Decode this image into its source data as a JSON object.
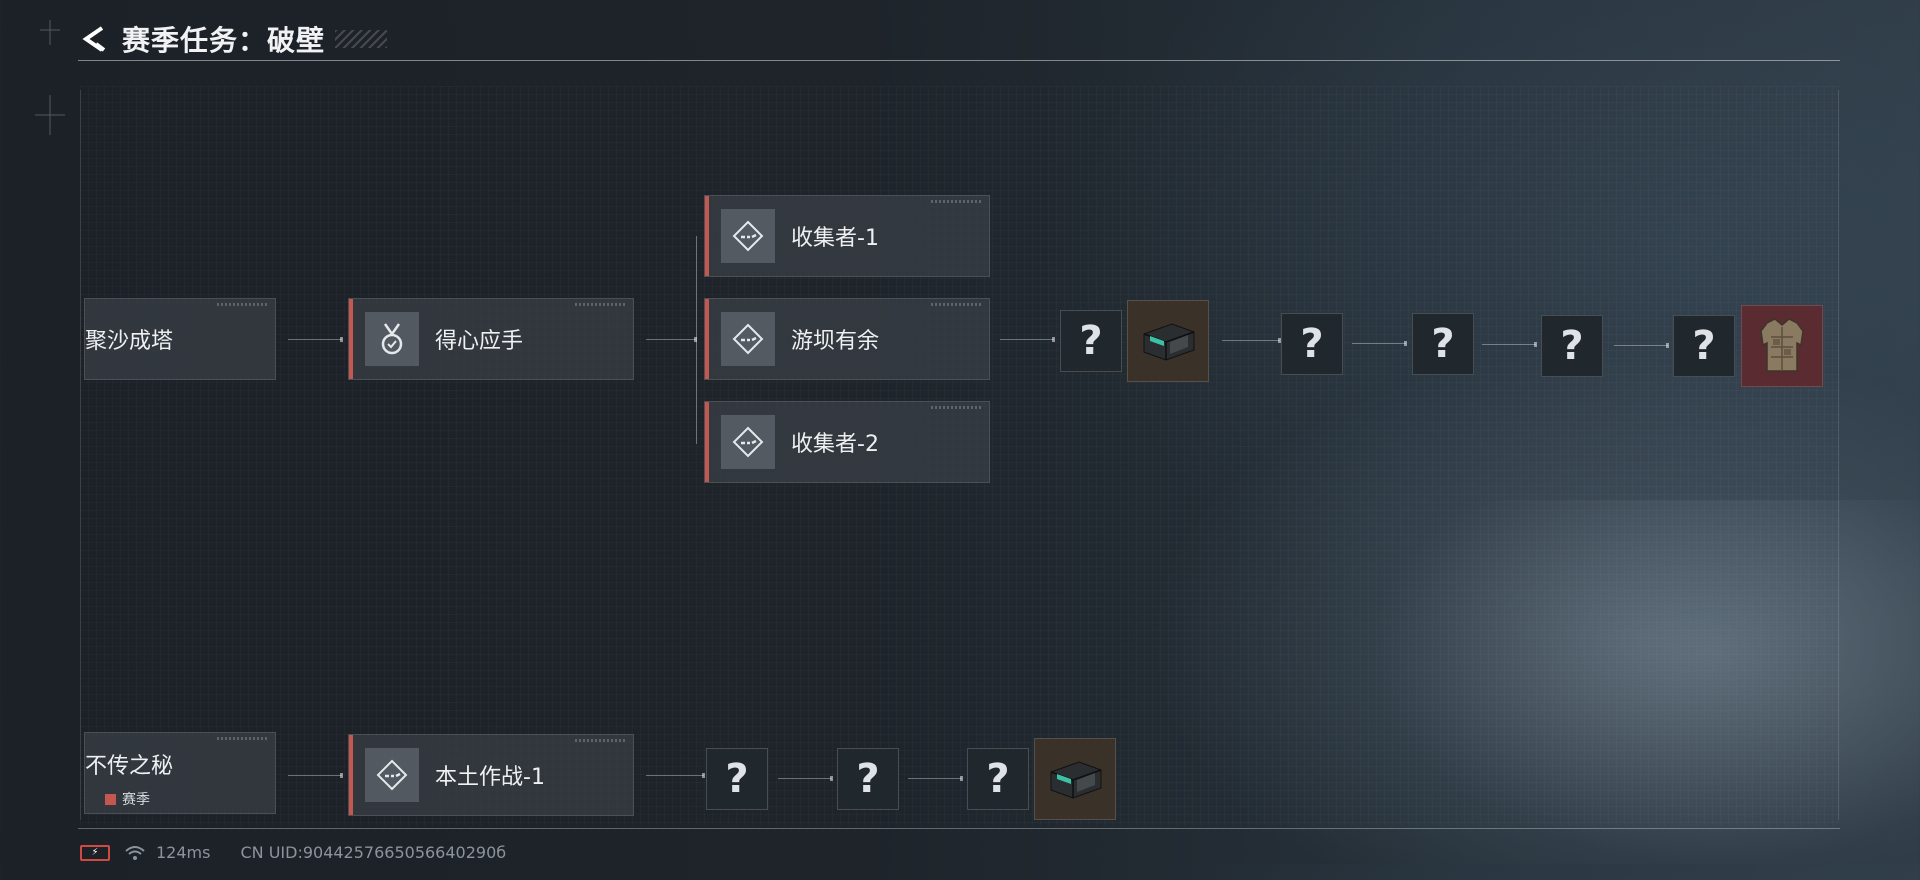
{
  "header": {
    "title": "赛季任务：破壁",
    "back_icon": "back-arrow-icon"
  },
  "row1": {
    "prev_task": "聚沙成塔",
    "task": "得心应手",
    "task_icon": "medal-icon",
    "branches": [
      {
        "label": "收集者-1",
        "icon": "diamond-dots-icon"
      },
      {
        "label": "游坝有余",
        "icon": "diamond-dots-icon"
      },
      {
        "label": "收集者-2",
        "icon": "diamond-dots-icon"
      }
    ],
    "rewards": [
      "?",
      "supply-case-icon",
      "?",
      "?",
      "?",
      "?",
      "body-armor-icon"
    ]
  },
  "row2": {
    "prev_task": "不传之秘",
    "prev_tag": "赛季",
    "task": "本土作战-1",
    "task_icon": "diamond-dots-icon",
    "rewards": [
      "?",
      "?",
      "?",
      "supply-case-icon"
    ]
  },
  "status": {
    "ping": "124ms",
    "uid": "CN UID:9044257665056640290б"
  },
  "colors": {
    "accent": "#c4574f",
    "card_bg": "#3a4046",
    "armor_bg": "#5a2b30",
    "item_bg": "#3a3128"
  }
}
